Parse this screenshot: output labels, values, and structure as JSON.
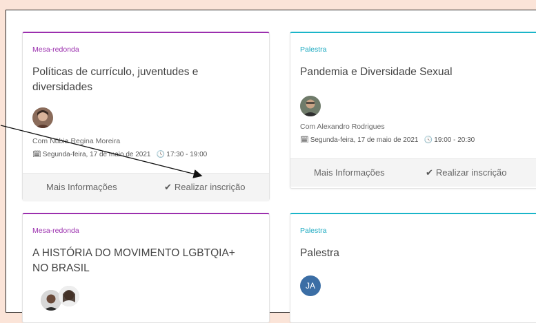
{
  "cards": [
    {
      "category": "Mesa-redonda",
      "title": "Políticas de currículo, juventudes e diversidades",
      "speaker": "Com Núbia Regina Moreira",
      "date": "Segunda-feira, 17 de maio de 2021",
      "time": "17:30 - 19:00",
      "more_label": "Mais Informações",
      "register_label": "Realizar inscrição"
    },
    {
      "category": "Palestra",
      "title": "Pandemia e Diversidade Sexual",
      "speaker": "Com Alexandro Rodrigues",
      "date": "Segunda-feira, 17 de maio de 2021",
      "time": "19:00 - 20:30",
      "more_label": "Mais Informações",
      "register_label": "Realizar inscrição"
    },
    {
      "category": "Mesa-redonda",
      "title": "A HISTÓRIA DO MOVIMENTO LGBTQIA+ NO BRASIL"
    },
    {
      "category": "Palestra",
      "title": "Palestra",
      "initials": "JA"
    }
  ],
  "colors": {
    "mesa_redonda": "#9b2fae",
    "palestra": "#1ab5c9",
    "avatar_initials_bg": "#3b6ea5"
  }
}
